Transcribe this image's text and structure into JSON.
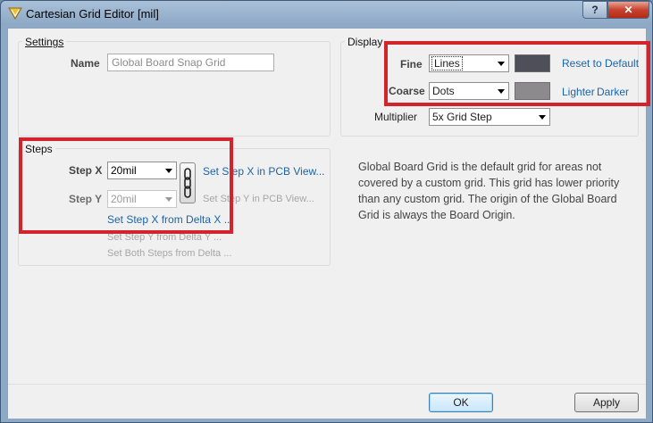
{
  "window": {
    "title": "Cartesian Grid Editor [mil]",
    "help_label": "?",
    "close_label": "✕"
  },
  "settings": {
    "legend": "Settings",
    "name_label": "Name",
    "name_value": "Global Board Snap Grid"
  },
  "display": {
    "legend": "Display",
    "fine_label": "Fine",
    "fine_value": "Lines",
    "fine_color": "#4f4f5a",
    "coarse_label": "Coarse",
    "coarse_value": "Dots",
    "coarse_color": "#8c8a8c",
    "reset_link": "Reset to Default",
    "lighter_link": "Lighter",
    "darker_link": "Darker",
    "multiplier_label": "Multiplier",
    "multiplier_value": "5x Grid Step"
  },
  "steps": {
    "legend": "Steps",
    "step_x_label": "Step X",
    "step_x_value": "20mil",
    "step_y_label": "Step Y",
    "step_y_value": "20mil",
    "set_x_pcb": "Set Step X in PCB View...",
    "set_y_pcb": "Set Step Y in PCB View...",
    "set_x_delta": "Set Step X from Delta X ...",
    "set_y_delta": "Set Step Y from Delta Y ...",
    "set_both_delta": "Set Both Steps from Delta ..."
  },
  "description": "Global Board Grid is the default grid for areas not covered by a custom grid. This grid has lower priority than any custom grid. The origin of the Global Board Grid is always the Board Origin.",
  "buttons": {
    "ok": "OK",
    "apply": "Apply"
  },
  "colors": {
    "highlight": "#d3232c",
    "link": "#1b64a8",
    "titlebar": "#8ea9c6"
  }
}
